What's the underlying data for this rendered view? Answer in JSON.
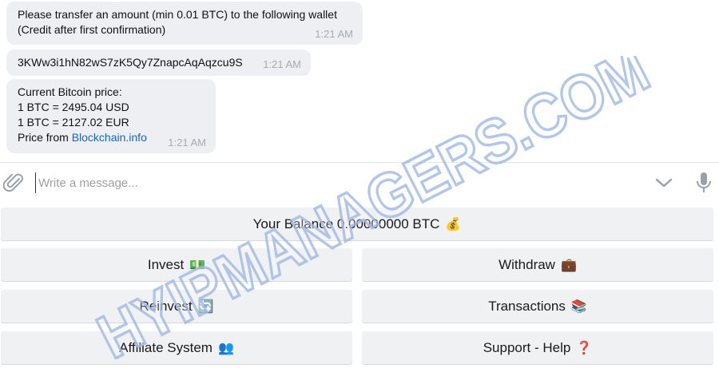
{
  "messages": [
    {
      "lines": [
        "Please transfer an amount (min 0.01 BTC) to the following wallet",
        "(Credit after first confirmation)"
      ],
      "time": "1:21 AM"
    },
    {
      "lines": [
        "3KWw3i1hN82wS7zK5Qy7ZnapcAqAqzcu9S"
      ],
      "time": "1:21 AM"
    },
    {
      "lines": [
        "Current Bitcoin price:",
        "1 BTC = 2495.04 USD",
        "1 BTC = 2127.02 EUR"
      ],
      "price_from_prefix": "Price from ",
      "price_from_link": "Blockchain.info",
      "time": "1:21 AM"
    }
  ],
  "composer": {
    "placeholder": "Write a message...",
    "attach_icon": "paperclip-icon",
    "expand_icon": "chevron-down-icon",
    "mic_icon": "microphone-icon"
  },
  "keyboard": {
    "balance": {
      "label": "Your Balance 0.00000000 BTC",
      "emoji": "💰"
    },
    "invest": {
      "label": "Invest",
      "emoji": "💵"
    },
    "withdraw": {
      "label": "Withdraw",
      "emoji": "💼"
    },
    "reinvest": {
      "label": "Reinvest",
      "emoji": "🔄"
    },
    "transactions": {
      "label": "Transactions",
      "emoji": "📚"
    },
    "affiliate": {
      "label": "Affiliate System",
      "emoji": "👥"
    },
    "support": {
      "label": "Support - Help",
      "emoji": "❓"
    }
  },
  "watermark": {
    "text": "HYIPMANAGERS.COM",
    "color": "#9fb8e3"
  },
  "colors": {
    "bubble": "#eeeff3",
    "time": "#a5abb3",
    "link": "#1565c0",
    "key_button": "#f0f1f3"
  }
}
